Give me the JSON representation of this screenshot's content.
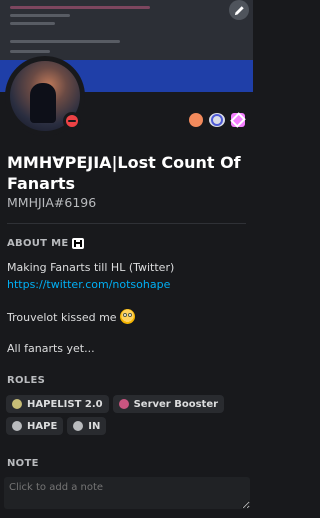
{
  "profile": {
    "display_name": "MMHꓯPEJIA|Lost Count Of Fanarts",
    "tag": "MMHJIA#6196",
    "status": "dnd"
  },
  "badges": [
    "hypesquad-icon",
    "nitro-icon",
    "server-boost-icon"
  ],
  "about": {
    "title": "ABOUT ME",
    "line1": "Making Fanarts till HL (Twitter)",
    "link": "https://twitter.com/notsohape",
    "line2": "Trouvelot kissed me",
    "line3": "All fanarts yet..."
  },
  "roles": {
    "title": "ROLES",
    "items": [
      {
        "label": "HAPELIST 2.0",
        "color": "#c7bd77"
      },
      {
        "label": "Server Booster",
        "color": "#c85580"
      },
      {
        "label": "HAPE",
        "color": "#b9bbbe"
      },
      {
        "label": "IN",
        "color": "#b9bbbe"
      }
    ]
  },
  "note": {
    "title": "NOTE",
    "placeholder": "Click to add a note"
  },
  "colors": {
    "background": "#18191c",
    "banner_band": "#1f3fa8",
    "link": "#00aff4",
    "dnd": "#ed4245"
  }
}
